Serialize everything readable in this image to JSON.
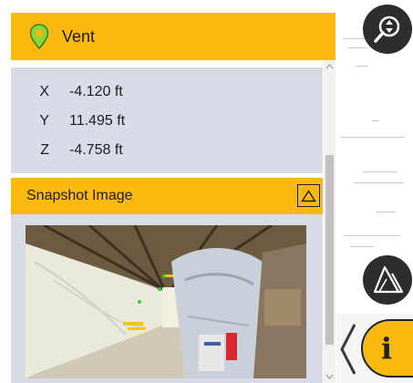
{
  "header": {
    "title": "Vent",
    "icon": "map-pin-icon",
    "accent": "#fbb80f"
  },
  "coordinates": {
    "rows": [
      {
        "axis": "X",
        "value": "-4.120 ft"
      },
      {
        "axis": "Y",
        "value": "11.495 ft"
      },
      {
        "axis": "Z",
        "value": "-4.758 ft"
      }
    ]
  },
  "snapshot": {
    "title": "Snapshot Image"
  },
  "tools": {
    "zoom_icon": "zoom-icon",
    "measure_icon": "triangle-measure-icon",
    "info_icon": "info-icon",
    "info_glyph": "i"
  },
  "colors": {
    "panel": "#d8dce6",
    "accent": "#fbb80f",
    "button": "#2d2d2d"
  }
}
